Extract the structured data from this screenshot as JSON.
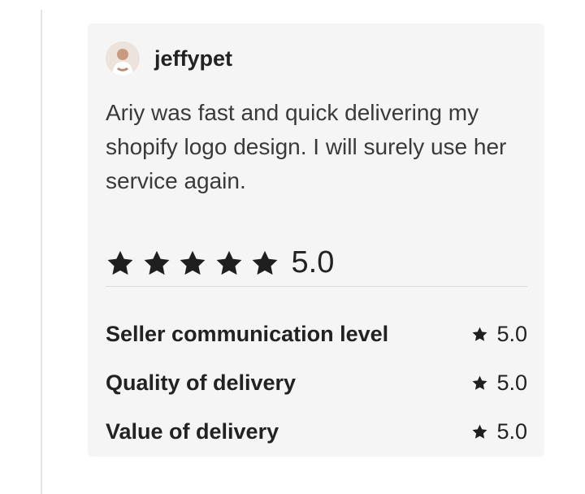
{
  "review": {
    "username": "jeffypet",
    "avatar_icon": "user-avatar-photo",
    "text": "Ariy was fast and quick delivering my shopify logo design. I will surely use her service again.",
    "overall_rating": "5.0",
    "stars_filled": 5,
    "star_color": "#1f1f1f",
    "criteria": [
      {
        "label": "Seller communication level",
        "value": "5.0"
      },
      {
        "label": "Quality of delivery",
        "value": "5.0"
      },
      {
        "label": "Value of delivery",
        "value": "5.0"
      }
    ]
  }
}
